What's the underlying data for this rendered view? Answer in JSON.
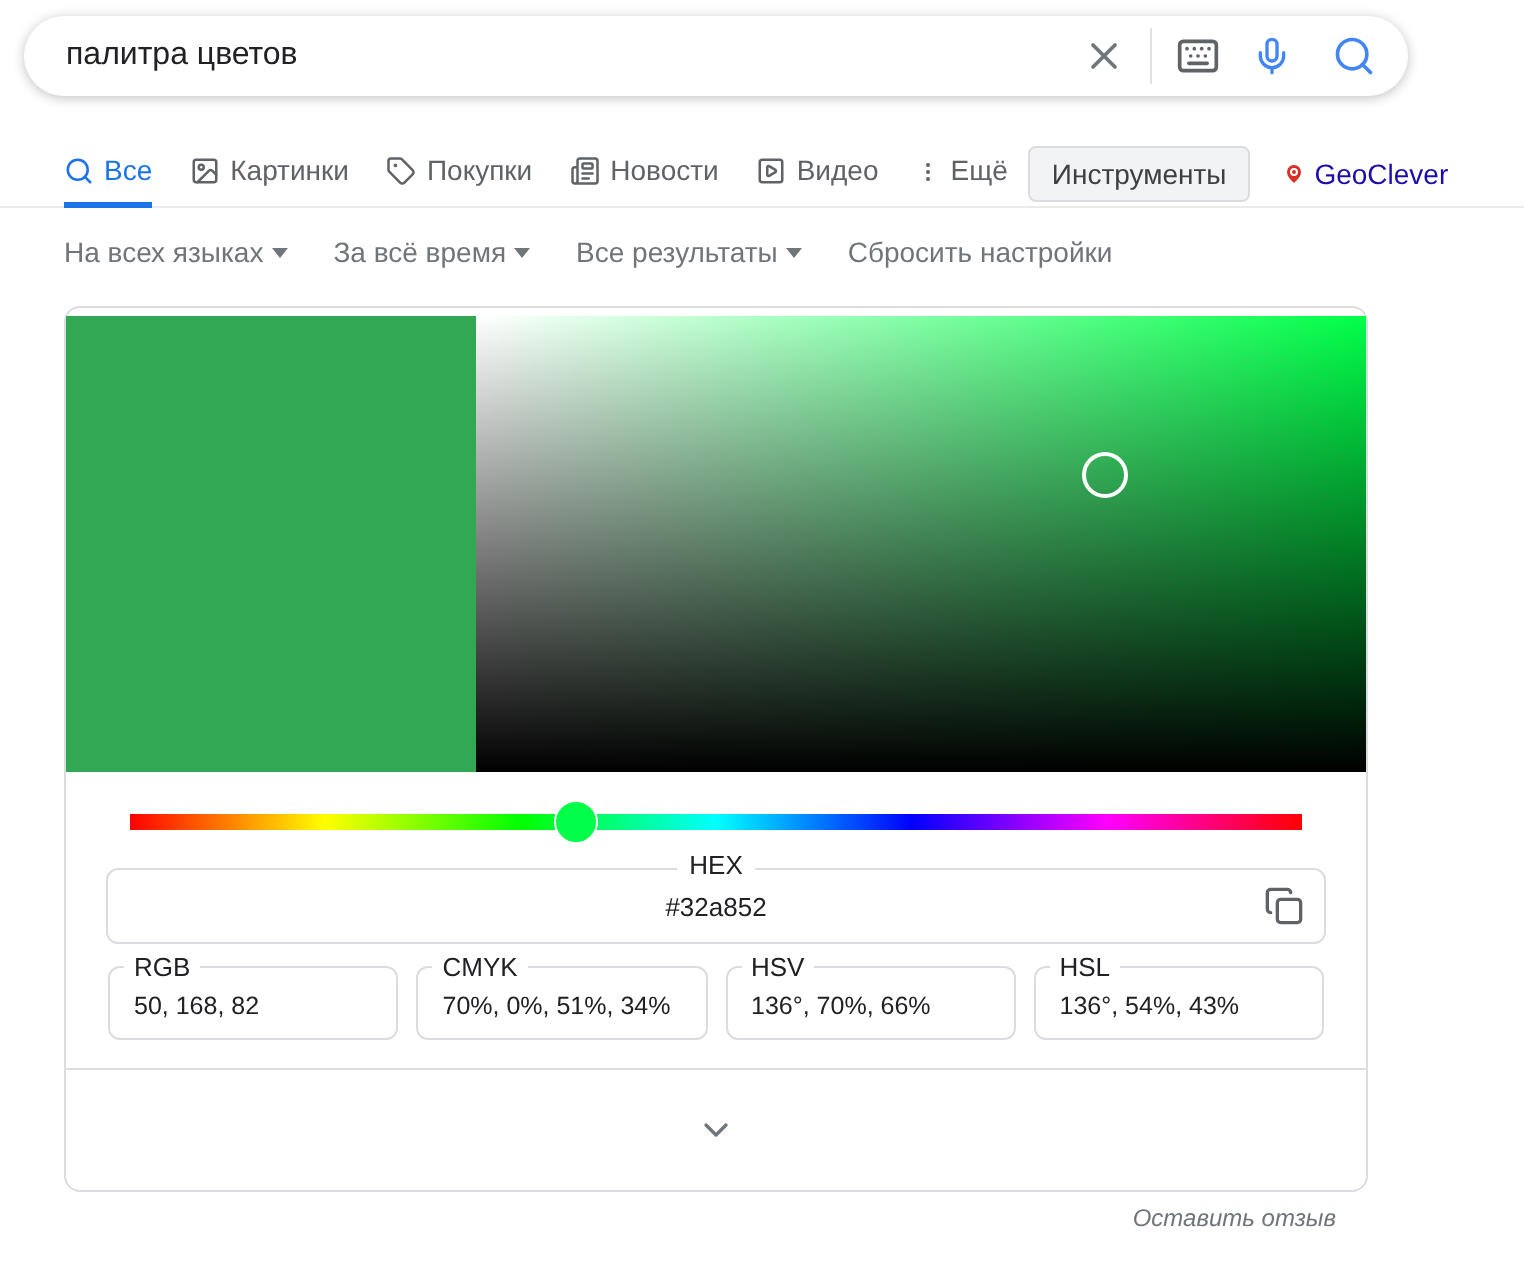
{
  "search": {
    "value": "палитра цветов"
  },
  "tabs": [
    {
      "label": "Все",
      "selected": true
    },
    {
      "label": "Картинки",
      "selected": false
    },
    {
      "label": "Покупки",
      "selected": false
    },
    {
      "label": "Новости",
      "selected": false
    },
    {
      "label": "Видео",
      "selected": false
    },
    {
      "label": "Ещё",
      "selected": false
    }
  ],
  "tools_button": "Инструменты",
  "extension_link": "GeoClever",
  "filters": [
    {
      "label": "На всех языках",
      "dropdown": true
    },
    {
      "label": "За всё время",
      "dropdown": true
    },
    {
      "label": "Все результаты",
      "dropdown": true
    },
    {
      "label": "Сбросить настройки",
      "dropdown": false
    }
  ],
  "color_picker": {
    "swatch": {
      "color": "#32a852"
    },
    "hue_slider": {
      "level": 0.38
    },
    "hex": {
      "label": "HEX",
      "value": "#32a852"
    },
    "fields": [
      {
        "label": "RGB",
        "value": "50, 168, 82"
      },
      {
        "label": "CMYK",
        "value": "70%, 0%, 51%, 34%"
      },
      {
        "label": "HSV",
        "value": "136°, 70%, 66%"
      },
      {
        "label": "HSL",
        "value": "136°, 54%, 43%"
      }
    ]
  },
  "feedback_link": "Оставить отзыв"
}
